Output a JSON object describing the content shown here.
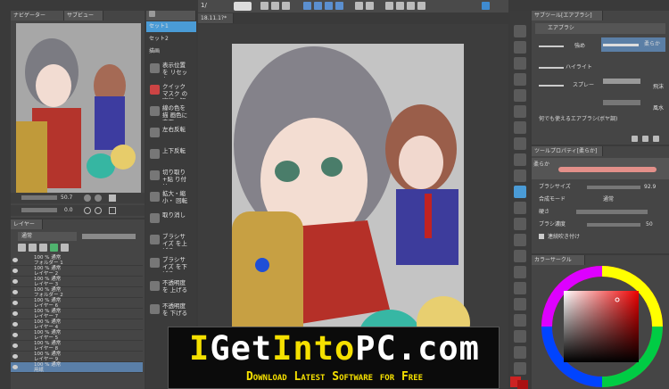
{
  "navigator": {
    "tab_navigator": "ナビゲーター",
    "tab_subview": "サブビュー",
    "zoom": "50.7",
    "angle": "0.0"
  },
  "canvas_tab": {
    "title": "18.11.1?*"
  },
  "toolbar": {
    "prefix": "1/"
  },
  "quick_menu": {
    "items": [
      {
        "label": "セット1"
      },
      {
        "label": "セット2"
      },
      {
        "label": "描画"
      },
      {
        "label": "表示位置を リセット"
      },
      {
        "label": "クイックマスク の実行・解除"
      },
      {
        "label": "線の色を描 画色に変更"
      },
      {
        "label": "左右反転"
      },
      {
        "label": "上下反転"
      },
      {
        "label": "切り取り+貼 り付け"
      },
      {
        "label": "拡大・縮小・ 回転"
      },
      {
        "label": "取り消し"
      },
      {
        "label": "ブラシサイズ を上げる"
      },
      {
        "label": "ブラシサイズ を下げる"
      },
      {
        "label": "不透明度を 上げる"
      },
      {
        "label": "不透明度を 下げる"
      }
    ]
  },
  "layers": {
    "tab_label": "レイヤー",
    "blend_mode": "通常",
    "rows": [
      {
        "line1": "100 % 通常",
        "line2": "フォルダー 1"
      },
      {
        "line1": "100 % 通常",
        "line2": "レイヤー 2"
      },
      {
        "line1": "100 % 通常",
        "line2": "レイヤー 3"
      },
      {
        "line1": "100 % 通常",
        "line2": "フォルダー 2"
      },
      {
        "line1": "100 % 通常",
        "line2": "レイヤー 6"
      },
      {
        "line1": "100 % 通常",
        "line2": "レイヤー 7"
      },
      {
        "line1": "100 % 通常",
        "line2": "レイヤー 4"
      },
      {
        "line1": "100 % 通常",
        "line2": "レイヤー 5"
      },
      {
        "line1": "100 % 通常",
        "line2": "レイヤー 8"
      },
      {
        "line1": "100 % 通常",
        "line2": "レイヤー 9"
      },
      {
        "line1": "100 % 通常",
        "line2": "用紙"
      }
    ]
  },
  "subtool": {
    "tab_label": "サブツール[エアブラシ]",
    "group": "エアブラシ",
    "brushes": [
      {
        "label": "強め"
      },
      {
        "label": "柔らか"
      },
      {
        "label": "ハイライト"
      },
      {
        "label": "スプレー"
      },
      {
        "label": "飛沫"
      },
      {
        "label": "風水"
      },
      {
        "label": "何でも使えるエアブラシ(ボヤ調)"
      }
    ]
  },
  "tool_property": {
    "tab_label": "ツールプロパティ[柔らか]",
    "brush_name": "柔らか",
    "rows": [
      {
        "label": "ブラシサイズ",
        "value": "92.9"
      },
      {
        "label": "合成モード",
        "value": "通常"
      },
      {
        "label": "硬さ",
        "value": ""
      },
      {
        "label": "ブラシ濃度",
        "value": "50"
      },
      {
        "label": "連続吹き付け",
        "value": ""
      }
    ]
  },
  "color_circle": {
    "tab_label": "カラーサークル"
  },
  "watermark": {
    "title_i": "I",
    "title_get": "Get",
    "title_into": "Into",
    "title_pc": "PC",
    "title_com": ".com",
    "subtitle": "Download Latest Software for Free"
  },
  "colors": {
    "panel_bg": "#454545",
    "accent_blue": "#4a9bd6",
    "watermark_yellow": "#f5e000",
    "watermark_bg": "#0b0b0b"
  }
}
